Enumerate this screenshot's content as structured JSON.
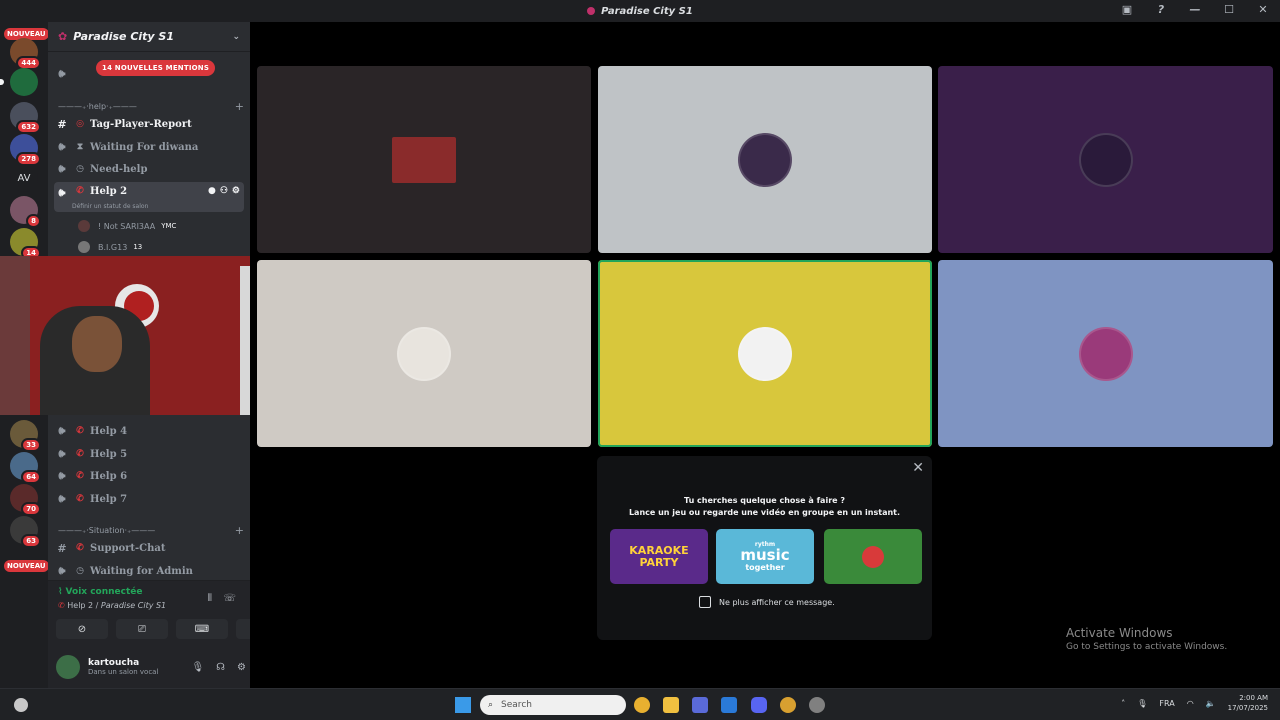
{
  "window": {
    "title": "Paradise City S1"
  },
  "guilds": {
    "nouveau_top": "NOUVEAU",
    "nouveau_bottom": "NOUVEAU",
    "av_label": "AV",
    "badges": [
      "444",
      "632",
      "278",
      "8",
      "14",
      "33",
      "64",
      "70",
      "63"
    ]
  },
  "sidebar": {
    "server_name": "Paradise City S1",
    "mention_pill": "14 NOUVELLES MENTIONS",
    "category_help": "———₊‧help‧₊———",
    "category_situation": "———₊‧Situation‧₊———",
    "channels": {
      "tag_player_report": "Tag-Player-Report",
      "waiting_for_diwana": "Waiting For diwana",
      "need_help": "Need-help",
      "help2": "Help 2",
      "help2_status": "Définir un statut de salon",
      "help4": "Help 4",
      "help5": "Help 5",
      "help6": "Help 6",
      "help7": "Help 7",
      "support_chat": "Support-Chat",
      "waiting_for_admin": "Waiting for Admin"
    },
    "members": [
      {
        "name": "! Not SARI3AA",
        "tag": "YMC"
      },
      {
        "name": "B.I.G13",
        "tag": "13"
      }
    ]
  },
  "voice_panel": {
    "status": "Voix connectée",
    "channel": "Help 2",
    "server": "Paradise City S1",
    "user_name": "kartoucha",
    "user_status": "Dans un salon vocal"
  },
  "activity": {
    "line1": "Tu cherches quelque chose à faire ?",
    "line2": "Lance un jeu ou regarde une vidéo en groupe en un instant.",
    "card1": "KARAOKE PARTY",
    "card2_brand": "rythm",
    "card2_main": "music",
    "card2_sub": "together",
    "checkbox_label": "Ne plus afficher ce message."
  },
  "tiles_colors": [
    "#2a2527",
    "#bfc3c6",
    "#3a1f4a",
    "#cfcac4",
    "#d8c73c",
    "#7f94c2"
  ],
  "watermark": {
    "line1": "Activate Windows",
    "line2": "Go to Settings to activate Windows."
  },
  "taskbar": {
    "search_placeholder": "Search",
    "language": "FRA",
    "time": "2:00 AM",
    "date": "17/07/2025"
  }
}
